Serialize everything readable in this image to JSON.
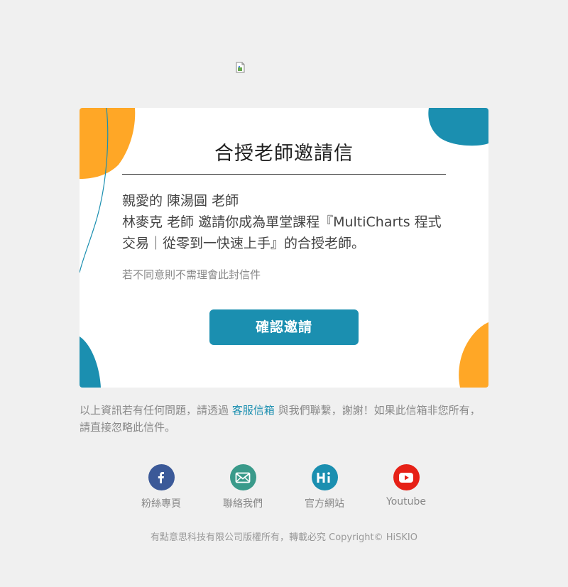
{
  "card": {
    "title": "合授老師邀請信",
    "greeting": "親愛的 陳湯圓 老師",
    "invite_message": "林麥克 老師 邀請你成為單堂課程『MultiCharts 程式交易｜從零到一快速上手』的合授老師。",
    "decline_note": "若不同意則不需理會此封信件",
    "confirm_button": "確認邀請"
  },
  "footer": {
    "text_before": "以上資訊若有任何問題，請透過 ",
    "support_link": "客服信箱",
    "text_after": " 與我們聯繫，謝謝！如果此信箱非您所有，請直接忽略此信件。"
  },
  "social": [
    {
      "label": "粉絲專頁",
      "icon": "facebook-icon",
      "color": "#3b5998"
    },
    {
      "label": "聯絡我們",
      "icon": "mail-icon",
      "color": "#3a9a8a"
    },
    {
      "label": "官方網站",
      "icon": "hi-icon",
      "color": "#1b8fb0"
    },
    {
      "label": "Youtube",
      "icon": "youtube-icon",
      "color": "#e62117"
    }
  ],
  "copyright": "有點意思科技有限公司版權所有，轉載必究 Copyright© HiSKIO",
  "colors": {
    "accent": "#1b8fb0",
    "orange": "#ffa726",
    "teal": "#1b8fb0"
  }
}
